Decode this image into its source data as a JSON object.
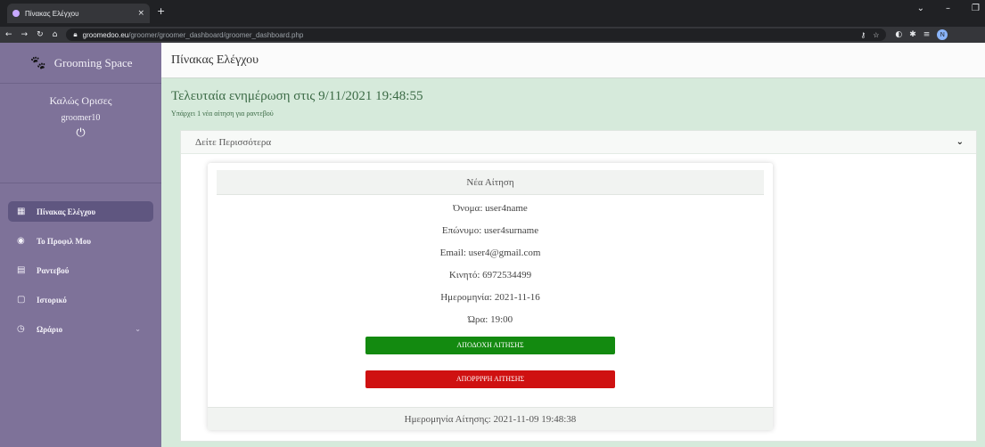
{
  "browser": {
    "tab_title": "Πίνακας Ελέγχου",
    "tab_close": "×",
    "new_tab": "+",
    "url_host": "groomedoo.eu",
    "url_path": "/groomer/groomer_dashboard/groomer_dashboard.php",
    "profile_initial": "N",
    "window_minimize": "–",
    "window_restore": "❐",
    "tab_list": "⌄"
  },
  "sidebar": {
    "brand": "Grooming Space",
    "greeting": "Καλώς Ορισες",
    "username": "groomer10",
    "items": [
      {
        "label": "Πίνακας Ελέγχου",
        "icon": "dashboard-icon"
      },
      {
        "label": "Το Προφιλ Μου",
        "icon": "profile-icon"
      },
      {
        "label": "Ραντεβού",
        "icon": "calendar-icon"
      },
      {
        "label": "Ιστορικό",
        "icon": "history-icon"
      },
      {
        "label": "Ωράριο",
        "icon": "clock-icon"
      }
    ]
  },
  "main": {
    "page_title": "Πίνακας Ελέγχου",
    "last_update": "Τελευταία ενημέρωση στις 9/11/2021 19:48:55",
    "notice": "Υπάρχει 1 νέα αίτηση για ραντεβού",
    "collapse_title": "Δείτε Περισσότερα"
  },
  "request": {
    "title": "Νέα Αίτηση",
    "fields": [
      "Όνομα: user4name",
      "Επώνυμο: user4surname",
      "Email: user4@gmail.com",
      "Κινητό: 6972534499",
      "Ημερομηνία: 2021-11-16",
      "Ώρα: 19:00"
    ],
    "accept_label": "ΑΠΟΔΟΧΗ ΑΙΤΗΣΗΣ",
    "reject_label": "ΑΠΟΡΡΙΨΗ ΑΙΤΗΣΗΣ",
    "footer": "Ημερομηνία Αίτησης: 2021-11-09 19:48:38"
  },
  "colors": {
    "sidebar": "#7e7299",
    "main_bg": "#d6eadb",
    "accept": "#138a10",
    "reject": "#cf1111"
  }
}
